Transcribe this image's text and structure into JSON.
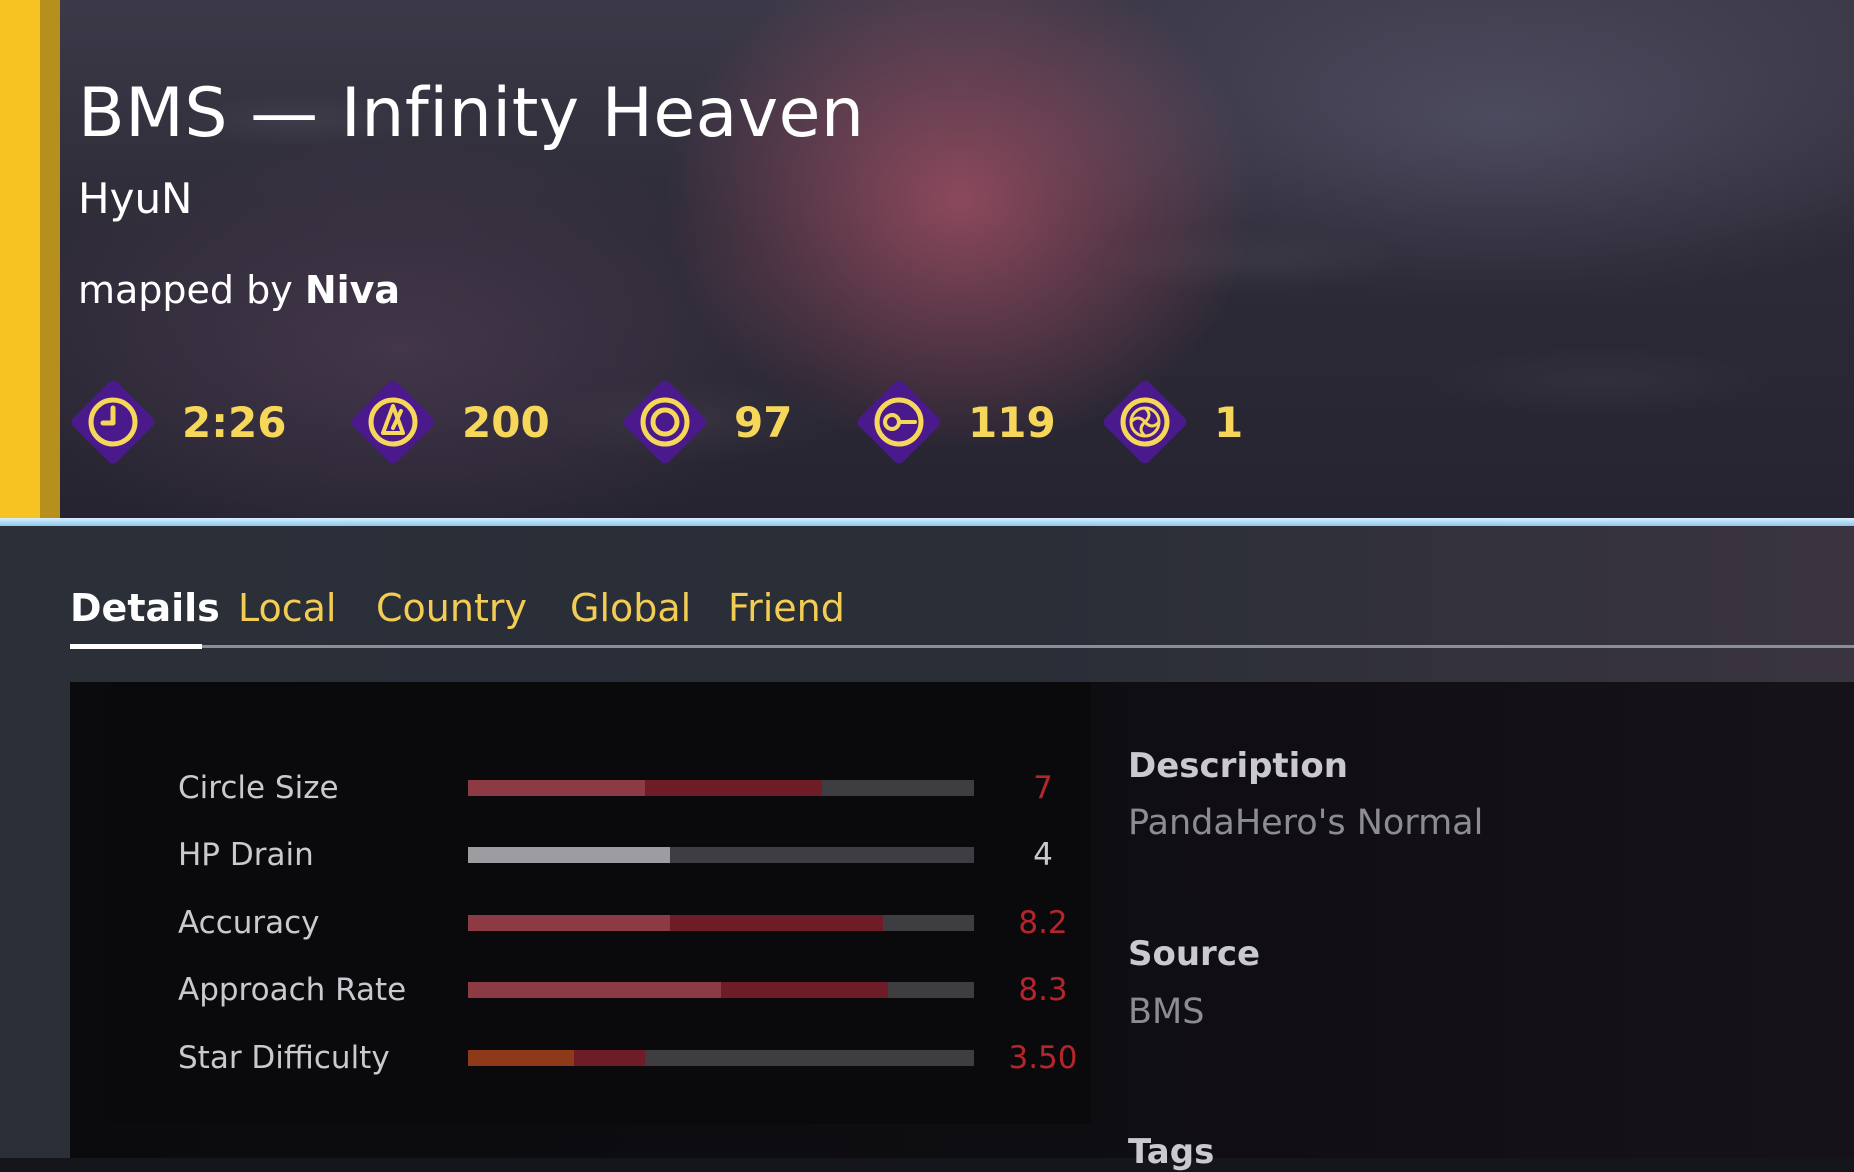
{
  "beatmap": {
    "title": "BMS — Infinity Heaven",
    "artist": "HyuN",
    "mapped_by_prefix": "mapped by",
    "mapper": "Niva"
  },
  "stats": [
    {
      "icon": "clock-icon",
      "value": "2:26"
    },
    {
      "icon": "bpm-metronome-icon",
      "value": "200"
    },
    {
      "icon": "circle-count-icon",
      "value": "97"
    },
    {
      "icon": "slider-count-icon",
      "value": "119"
    },
    {
      "icon": "spinner-count-icon",
      "value": "1"
    }
  ],
  "tabs": [
    {
      "label": "Details",
      "active": true
    },
    {
      "label": "Local",
      "active": false
    },
    {
      "label": "Country",
      "active": false
    },
    {
      "label": "Global",
      "active": false
    },
    {
      "label": "Friend",
      "active": false
    }
  ],
  "difficulty_stats": [
    {
      "label": "Circle Size",
      "value": "7",
      "fill": 0.7,
      "base_fill": 0.35
    },
    {
      "label": "HP Drain",
      "value": "4",
      "fill": 0.4,
      "base_fill": 0.4
    },
    {
      "label": "Accuracy",
      "value": "8.2",
      "fill": 0.82,
      "base_fill": 0.4
    },
    {
      "label": "Approach Rate",
      "value": "8.3",
      "fill": 0.83,
      "base_fill": 0.5
    },
    {
      "label": "Star Difficulty",
      "value": "3.50",
      "fill": 0.35,
      "base_fill": 0.21
    }
  ],
  "info": {
    "description_label": "Description",
    "description_value": "PandaHero's Normal",
    "source_label": "Source",
    "source_value": "BMS",
    "tags_label": "Tags"
  },
  "colors": {
    "accent_yellow": "#f6c323",
    "tab_inactive": "#f3cc54",
    "stat_value": "#f6d75a",
    "icon_diamond": "#4a1a8c",
    "modified_value_red": "#b5252c",
    "bar_base_red": "#8c3a44",
    "bar_mod_red": "#6e1c26",
    "bar_hp_grey": "#9d9da1",
    "bar_star_orange": "#8e3a1a"
  }
}
